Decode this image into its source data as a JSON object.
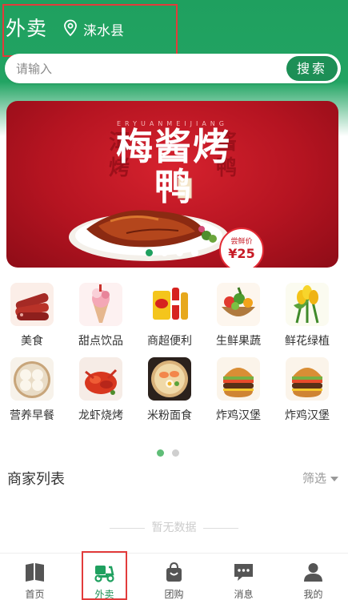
{
  "header": {
    "title": "外卖",
    "location": "涞水县",
    "location_icon": "location-pin-icon"
  },
  "search": {
    "placeholder": "请输入",
    "button_label": "搜索"
  },
  "banner": {
    "subtitle": "ERYUANMEIJIANG",
    "title": "梅酱烤鸭",
    "price_label": "尝鲜价",
    "price": "¥25",
    "dots_total": 4,
    "dots_active": 0
  },
  "categories": [
    {
      "label": "美食",
      "icon": "sausage-icon"
    },
    {
      "label": "甜点饮品",
      "icon": "ice-cream-icon"
    },
    {
      "label": "商超便利",
      "icon": "snacks-icon"
    },
    {
      "label": "生鲜果蔬",
      "icon": "fruit-basket-icon"
    },
    {
      "label": "鲜花绿植",
      "icon": "tulip-icon"
    },
    {
      "label": "营养早餐",
      "icon": "dumpling-icon"
    },
    {
      "label": "龙虾烧烤",
      "icon": "crayfish-icon"
    },
    {
      "label": "米粉面食",
      "icon": "noodle-bowl-icon"
    },
    {
      "label": "炸鸡汉堡",
      "icon": "burger-icon"
    },
    {
      "label": "炸鸡汉堡",
      "icon": "burger-icon"
    }
  ],
  "category_pager": {
    "total": 2,
    "active": 0
  },
  "merchant_section": {
    "title": "商家列表",
    "filter_label": "筛选",
    "empty_text": "暂无数据"
  },
  "tabbar": {
    "items": [
      {
        "label": "首页",
        "icon": "book-home-icon"
      },
      {
        "label": "外卖",
        "icon": "scooter-icon"
      },
      {
        "label": "团购",
        "icon": "shopping-bag-icon"
      },
      {
        "label": "消息",
        "icon": "chat-bubble-icon"
      },
      {
        "label": "我的",
        "icon": "user-icon"
      }
    ],
    "active_index": 1
  },
  "colors": {
    "brand_green": "#1fa05f",
    "button_green": "#1d8f56",
    "highlight_red": "#e23b3b",
    "banner_red": "#c71b26"
  }
}
